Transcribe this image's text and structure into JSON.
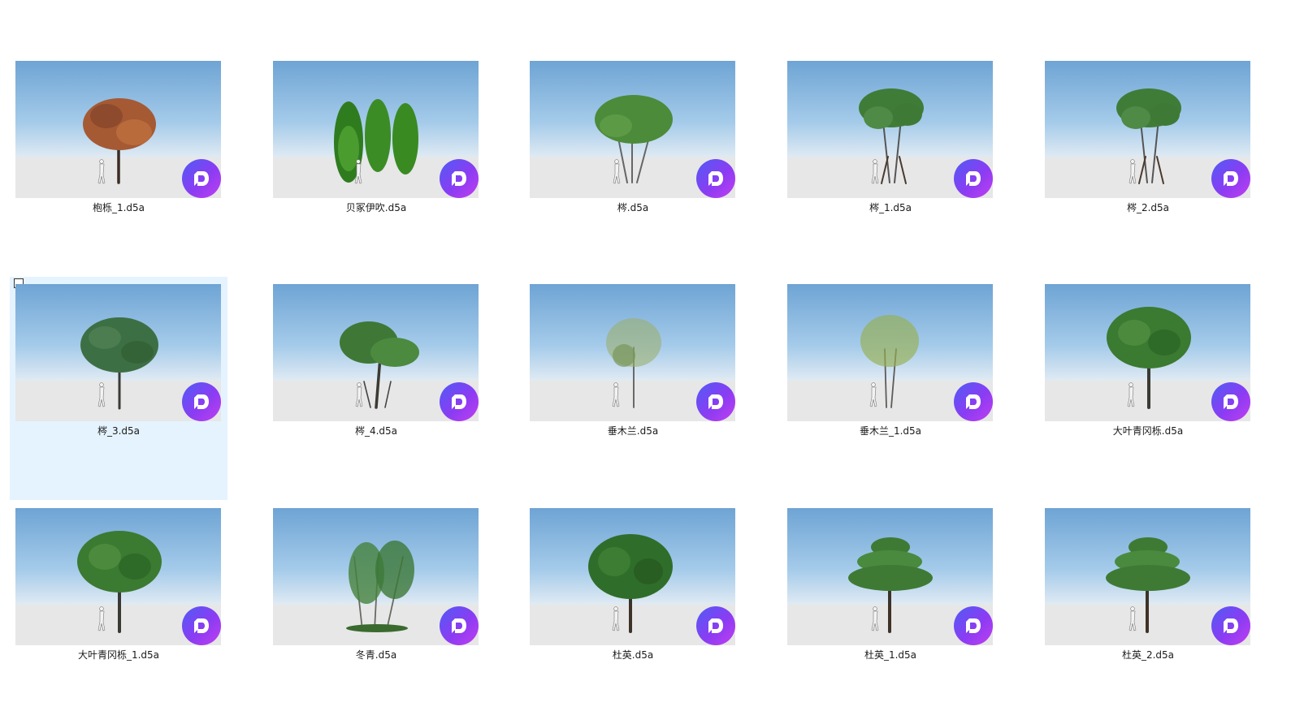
{
  "files": [
    {
      "name": "枹栎_1.d5a",
      "tree": "autumn"
    },
    {
      "name": "贝冢伊吹.d5a",
      "tree": "cypress"
    },
    {
      "name": "梣.d5a",
      "tree": "multi"
    },
    {
      "name": "梣_1.d5a",
      "tree": "staked"
    },
    {
      "name": "梣_2.d5a",
      "tree": "staked"
    },
    {
      "name": "梣_3.d5a",
      "tree": "broad",
      "selected": true
    },
    {
      "name": "梣_4.d5a",
      "tree": "leaning"
    },
    {
      "name": "垂木兰.d5a",
      "tree": "sparse"
    },
    {
      "name": "垂木兰_1.d5a",
      "tree": "sparse2"
    },
    {
      "name": "大叶青冈栎.d5a",
      "tree": "round"
    },
    {
      "name": "大叶青冈栎_1.d5a",
      "tree": "round"
    },
    {
      "name": "冬青.d5a",
      "tree": "shrub"
    },
    {
      "name": "杜英.d5a",
      "tree": "dense"
    },
    {
      "name": "杜英_1.d5a",
      "tree": "layered"
    },
    {
      "name": "杜英_2.d5a",
      "tree": "layered"
    }
  ],
  "colors": {
    "badge_start": "#4f5cf5",
    "badge_end": "#c23ef0",
    "selection": "#e5f3ff"
  }
}
